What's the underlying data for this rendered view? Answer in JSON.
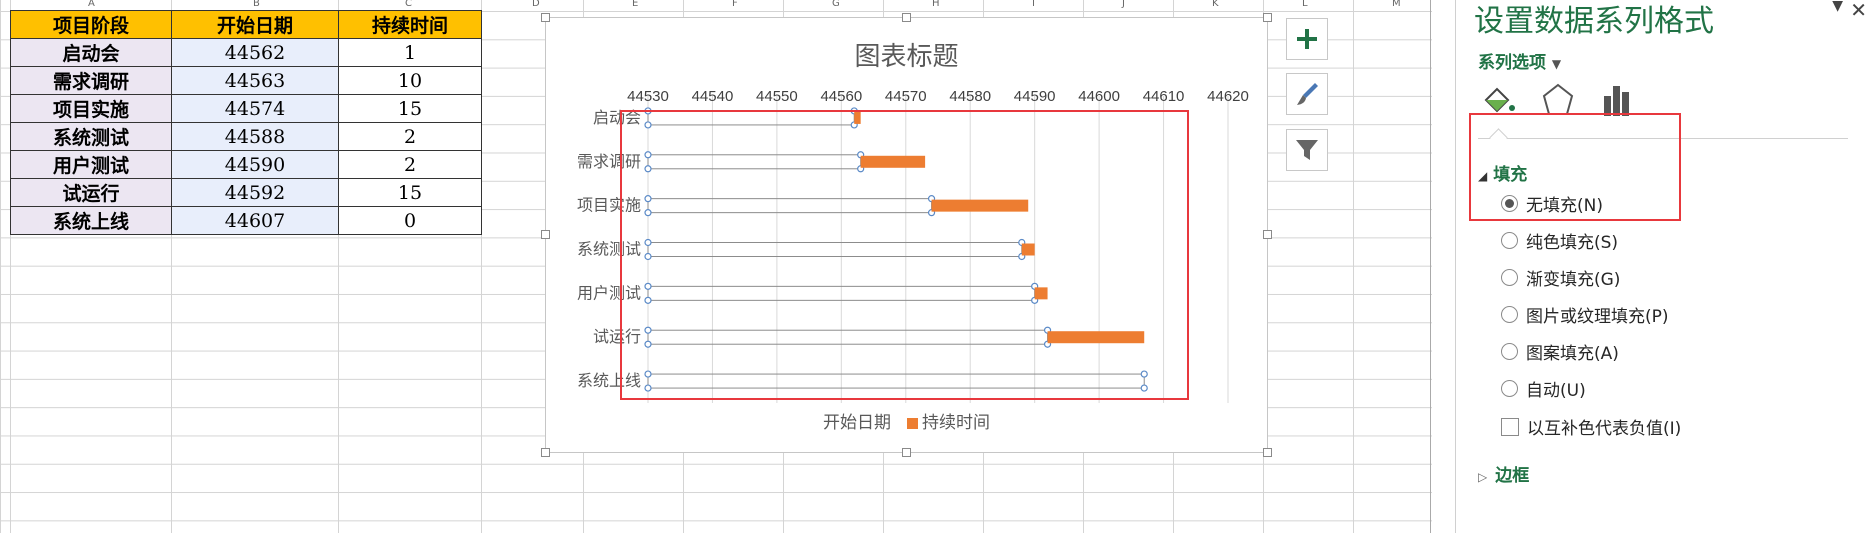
{
  "sheet": {
    "columns": [
      "A",
      "B",
      "C",
      "D",
      "E",
      "F",
      "G",
      "H",
      "I",
      "J",
      "K",
      "L",
      "M"
    ],
    "headers": [
      "项目阶段",
      "开始日期",
      "持续时间"
    ],
    "rows": [
      [
        "启动会",
        "44562",
        "1"
      ],
      [
        "需求调研",
        "44563",
        "10"
      ],
      [
        "项目实施",
        "44574",
        "15"
      ],
      [
        "系统测试",
        "44588",
        "2"
      ],
      [
        "用户测试",
        "44590",
        "2"
      ],
      [
        "试运行",
        "44592",
        "15"
      ],
      [
        "系统上线",
        "44607",
        "0"
      ]
    ]
  },
  "chart_data": {
    "type": "bar",
    "orientation": "horizontal-stacked",
    "title": "图表标题",
    "categories": [
      "启动会",
      "需求调研",
      "项目实施",
      "系统测试",
      "用户测试",
      "试运行",
      "系统上线"
    ],
    "series": [
      {
        "name": "开始日期",
        "values": [
          44562,
          44563,
          44574,
          44588,
          44590,
          44592,
          44607
        ],
        "fill": "none"
      },
      {
        "name": "持续时间",
        "values": [
          1,
          10,
          15,
          2,
          2,
          15,
          0
        ],
        "color": "#ed7d31"
      }
    ],
    "xlim": [
      44530,
      44620
    ],
    "xticks": [
      "44530",
      "44540",
      "44550",
      "44560",
      "44570",
      "44580",
      "44590",
      "44600",
      "44610",
      "44620"
    ],
    "grid": true,
    "legend": "bottom"
  },
  "chart_tools": {
    "icons": [
      "plus-icon",
      "brush-icon",
      "filter-icon"
    ]
  },
  "panel": {
    "title": "设置数据系列格式",
    "series_options": "系列选项",
    "fill_section": "填充",
    "border_section": "边框",
    "fill_options": [
      {
        "label": "无填充(N)",
        "selected": true
      },
      {
        "label": "纯色填充(S)",
        "selected": false
      },
      {
        "label": "渐变填充(G)",
        "selected": false
      },
      {
        "label": "图片或纹理填充(P)",
        "selected": false
      },
      {
        "label": "图案填充(A)",
        "selected": false
      },
      {
        "label": "自动(U)",
        "selected": false
      }
    ],
    "invert_label": "以互补色代表负值(I)",
    "accent": "#217346",
    "highlight": "#e8383d"
  }
}
